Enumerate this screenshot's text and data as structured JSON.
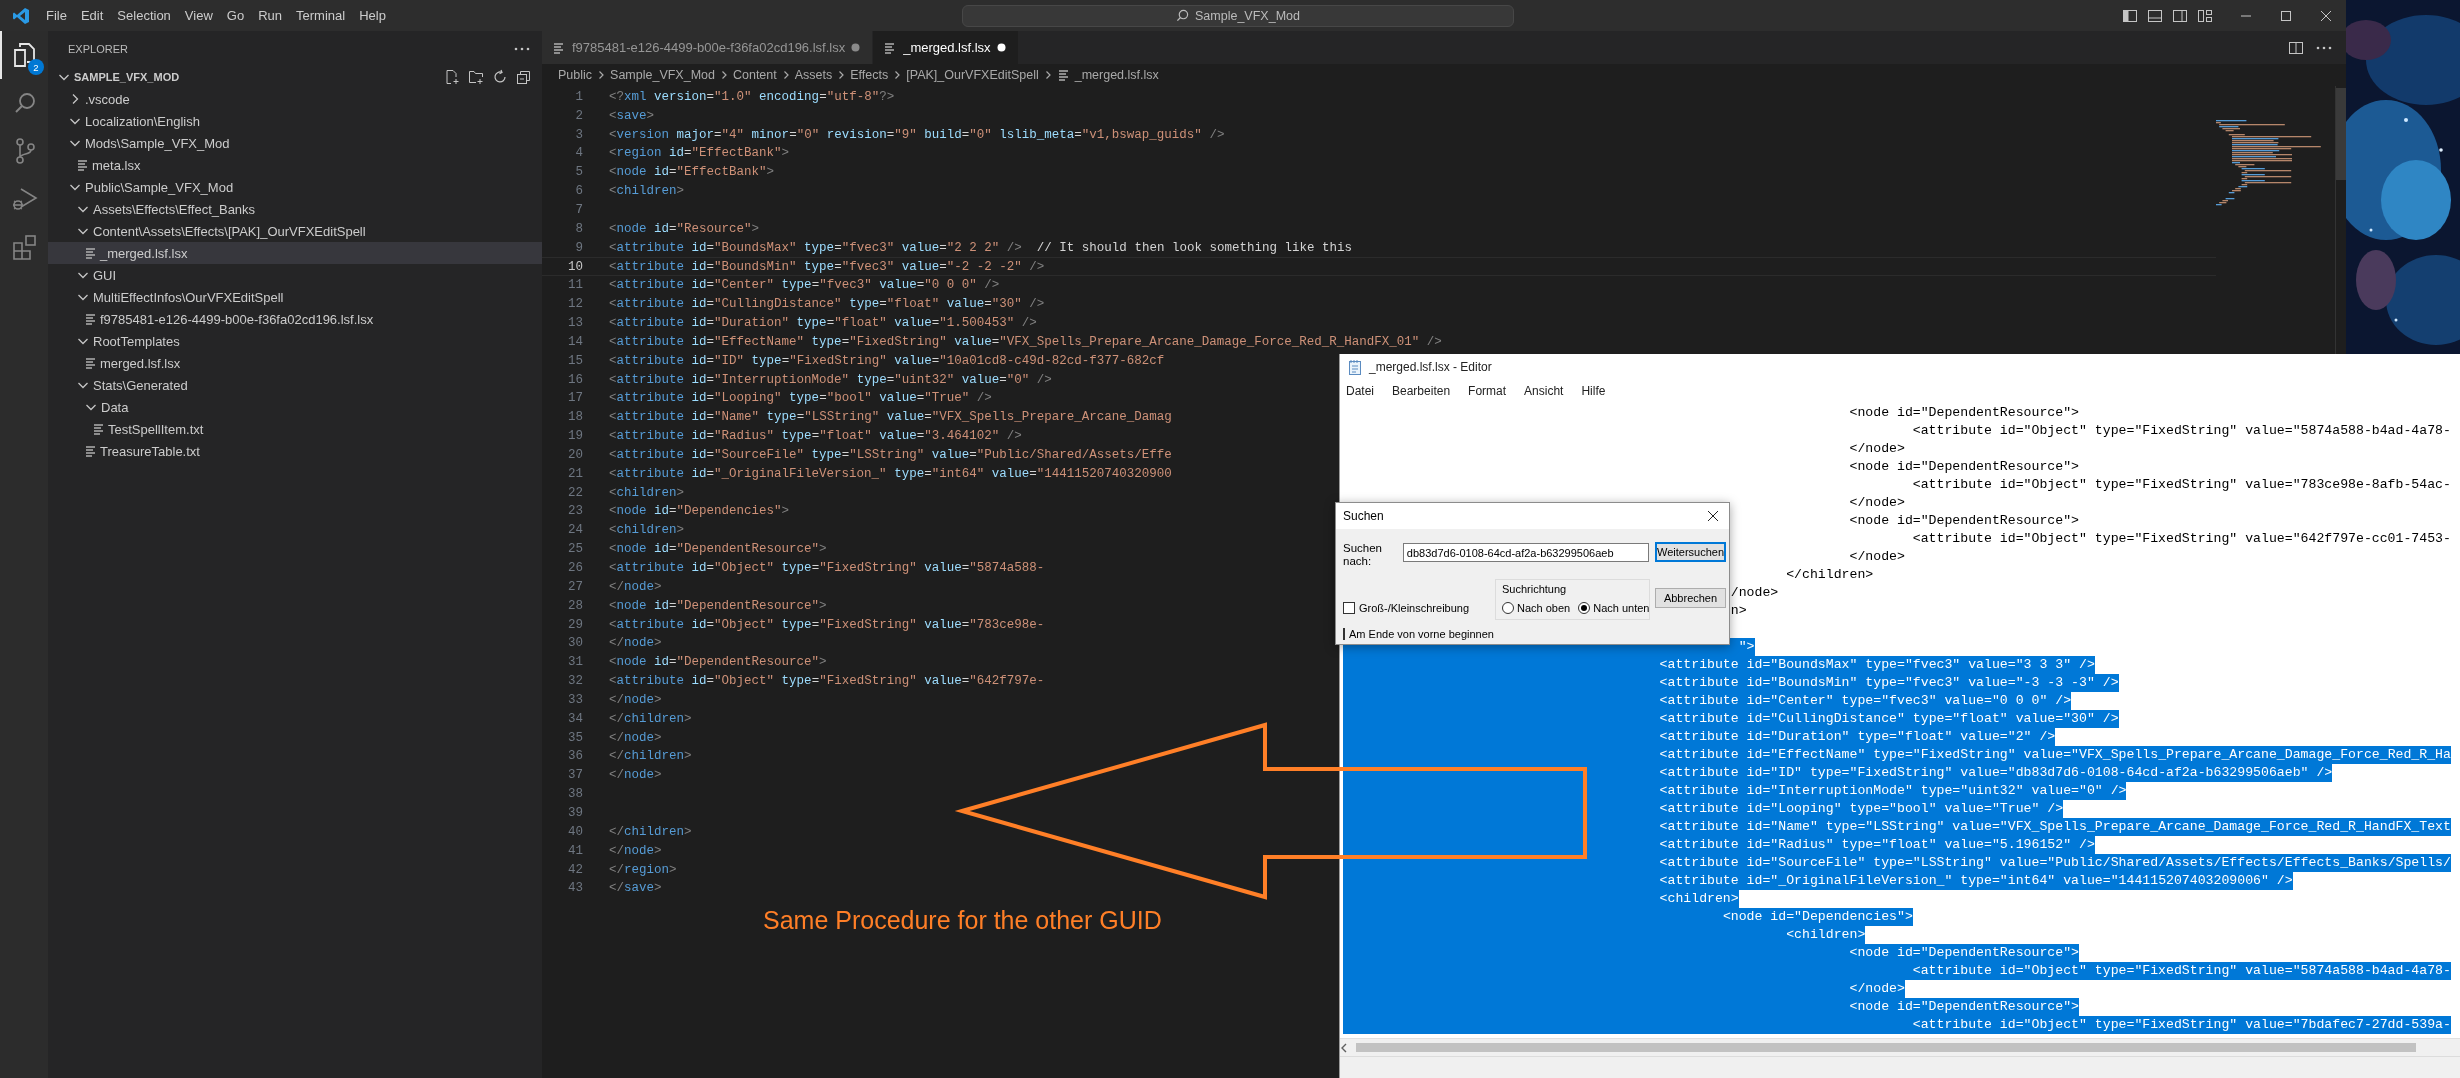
{
  "titlebar": {
    "menu": [
      "File",
      "Edit",
      "Selection",
      "View",
      "Go",
      "Run",
      "Terminal",
      "Help"
    ],
    "search": "Sample_VFX_Mod"
  },
  "activity_bar": [
    {
      "kind": "files",
      "selected": true,
      "badge": "2"
    },
    {
      "kind": "search",
      "selected": false
    },
    {
      "kind": "source_control",
      "selected": false
    },
    {
      "kind": "run",
      "selected": false
    },
    {
      "kind": "extensions",
      "selected": false
    }
  ],
  "explorer": {
    "title": "EXPLORER",
    "root": {
      "label": "SAMPLE_VFX_MOD",
      "expanded": true
    },
    "tree": [
      {
        "label": ".vscode",
        "kind": "folder",
        "expanded": false,
        "selected": false
      },
      {
        "label": "Localization\\English",
        "kind": "folder",
        "expanded": true,
        "selected": false
      },
      {
        "label": "Mods\\Sample_VFX_Mod",
        "kind": "folder",
        "expanded": true,
        "selected": false,
        "children": [
          {
            "label": "meta.lsx",
            "kind": "file",
            "selected": false
          }
        ]
      },
      {
        "label": "Public\\Sample_VFX_Mod",
        "kind": "folder",
        "expanded": true,
        "selected": false,
        "children": [
          {
            "label": "Assets\\Effects\\Effect_Banks",
            "kind": "folder",
            "expanded": true,
            "selected": false
          },
          {
            "label": "Content\\Assets\\Effects\\[PAK]_OurVFXEditSpell",
            "kind": "folder",
            "expanded": true,
            "selected": false,
            "children": [
              {
                "label": "_merged.lsf.lsx",
                "kind": "file",
                "selected": true
              }
            ]
          },
          {
            "label": "GUI",
            "kind": "folder",
            "expanded": true,
            "selected": false
          },
          {
            "label": "MultiEffectInfos\\OurVFXEditSpell",
            "kind": "folder",
            "expanded": true,
            "selected": false,
            "children": [
              {
                "label": "f9785481-e126-4499-b00e-f36fa02cd196.lsf.lsx",
                "kind": "file",
                "selected": false
              }
            ]
          },
          {
            "label": "RootTemplates",
            "kind": "folder",
            "expanded": true,
            "selected": false,
            "children": [
              {
                "label": "merged.lsf.lsx",
                "kind": "file",
                "selected": false
              }
            ]
          },
          {
            "label": "Stats\\Generated",
            "kind": "folder",
            "expanded": true,
            "selected": false,
            "children": [
              {
                "label": "Data",
                "kind": "folder",
                "expanded": true,
                "selected": false,
                "children": [
                  {
                    "label": "TestSpellItem.txt",
                    "kind": "file",
                    "selected": false
                  }
                ]
              },
              {
                "label": "TreasureTable.txt",
                "kind": "file",
                "selected": false
              }
            ]
          }
        ]
      }
    ]
  },
  "tabs": [
    {
      "label": "f9785481-e126-4499-b00e-f36fa02cd196.lsf.lsx",
      "selected": false,
      "modified": true
    },
    {
      "label": "_merged.lsf.lsx",
      "selected": true,
      "modified": true
    }
  ],
  "breadcrumb": [
    "Public",
    "Sample_VFX_Mod",
    "Content",
    "Assets",
    "Effects",
    "[PAK]_OurVFXEditSpell",
    "_merged.lsf.lsx"
  ],
  "editor": {
    "lines": [
      {
        "n": "1",
        "text": "<?xml version=\"1.0\" encoding=\"utf-8\"?>",
        "current": false
      },
      {
        "n": "2",
        "text": "<save>",
        "current": false
      },
      {
        "n": "3",
        "text": "    <version major=\"4\" minor=\"0\" revision=\"9\" build=\"0\" lslib_meta=\"v1,bswap_guids\" />",
        "current": false
      },
      {
        "n": "4",
        "text": "    <region id=\"EffectBank\">",
        "current": false
      },
      {
        "n": "5",
        "text": "        <node id=\"EffectBank\">",
        "current": false
      },
      {
        "n": "6",
        "text": "            <children>",
        "current": false
      },
      {
        "n": "7",
        "current": false
      },
      {
        "n": "8",
        "text": "                <node id=\"Resource\">",
        "current": false
      },
      {
        "n": "9",
        "text": "                    <attribute id=\"BoundsMax\" type=\"fvec3\" value=\"2 2 2\" />  // It should then look something like this",
        "current": false
      },
      {
        "n": "10",
        "text": "                    <attribute id=\"BoundsMin\" type=\"fvec3\" value=\"-2 -2 -2\" />",
        "current": true
      },
      {
        "n": "11",
        "text": "                    <attribute id=\"Center\" type=\"fvec3\" value=\"0 0 0\" />",
        "current": false
      },
      {
        "n": "12",
        "text": "                    <attribute id=\"CullingDistance\" type=\"float\" value=\"30\" />",
        "current": false
      },
      {
        "n": "13",
        "text": "                    <attribute id=\"Duration\" type=\"float\" value=\"1.500453\" />",
        "current": false
      },
      {
        "n": "14",
        "text": "                    <attribute id=\"EffectName\" type=\"FixedString\" value=\"VFX_Spells_Prepare_Arcane_Damage_Force_Red_R_HandFX_01\" />",
        "current": false
      },
      {
        "n": "15",
        "text": "                    <attribute id=\"ID\" type=\"FixedString\" value=\"10a01cd8-c49d-82cd-f377-682cf",
        "current": false
      },
      {
        "n": "16",
        "text": "                    <attribute id=\"InterruptionMode\" type=\"uint32\" value=\"0\" />",
        "current": false
      },
      {
        "n": "17",
        "text": "                    <attribute id=\"Looping\" type=\"bool\" value=\"True\" />",
        "current": false
      },
      {
        "n": "18",
        "text": "                    <attribute id=\"Name\" type=\"LSString\" value=\"VFX_Spells_Prepare_Arcane_Damag",
        "current": false
      },
      {
        "n": "19",
        "text": "                    <attribute id=\"Radius\" type=\"float\" value=\"3.464102\" />",
        "current": false
      },
      {
        "n": "20",
        "text": "                    <attribute id=\"SourceFile\" type=\"LSString\" value=\"Public/Shared/Assets/Effe",
        "current": false
      },
      {
        "n": "21",
        "text": "                    <attribute id=\"_OriginalFileVersion_\" type=\"int64\" value=\"14411520740320900",
        "current": false
      },
      {
        "n": "22",
        "text": "                    <children>",
        "current": false
      },
      {
        "n": "23",
        "text": "                        <node id=\"Dependencies\">",
        "current": false
      },
      {
        "n": "24",
        "text": "                            <children>",
        "current": false
      },
      {
        "n": "25",
        "text": "                                <node id=\"DependentResource\">",
        "current": false
      },
      {
        "n": "26",
        "text": "                                    <attribute id=\"Object\" type=\"FixedString\" value=\"5874a588-",
        "current": false
      },
      {
        "n": "27",
        "text": "                                </node>",
        "current": false
      },
      {
        "n": "28",
        "text": "                                <node id=\"DependentResource\">",
        "current": false
      },
      {
        "n": "29",
        "text": "                                    <attribute id=\"Object\" type=\"FixedString\" value=\"783ce98e-",
        "current": false
      },
      {
        "n": "30",
        "text": "                                </node>",
        "current": false
      },
      {
        "n": "31",
        "text": "                                <node id=\"DependentResource\">",
        "current": false
      },
      {
        "n": "32",
        "text": "                                    <attribute id=\"Object\" type=\"FixedString\" value=\"642f797e-",
        "current": false
      },
      {
        "n": "33",
        "text": "                                </node>",
        "current": false
      },
      {
        "n": "34",
        "text": "                            </children>",
        "current": false
      },
      {
        "n": "35",
        "text": "                        </node>",
        "current": false
      },
      {
        "n": "36",
        "text": "                    </children>",
        "current": false
      },
      {
        "n": "37",
        "text": "                </node>",
        "current": false
      },
      {
        "n": "38",
        "current": false
      },
      {
        "n": "39",
        "current": false
      },
      {
        "n": "40",
        "text": "            </children>",
        "current": false
      },
      {
        "n": "41",
        "text": "        </node>",
        "current": false
      },
      {
        "n": "42",
        "text": "    </region>",
        "current": false
      },
      {
        "n": "43",
        "text": "</save>",
        "current": false
      }
    ]
  },
  "notepad": {
    "title": "_merged.lsf.lsx - Editor",
    "menu": [
      "Datei",
      "Bearbeiten",
      "Format",
      "Ansicht",
      "Hilfe"
    ],
    "lines": [
      {
        "text": "\t\t\t\t\t\t\t\t<node id=\"DependentResource\">",
        "selected": false
      },
      {
        "text": "\t\t\t\t\t\t\t\t\t<attribute id=\"Object\" type=\"FixedString\" value=\"5874a588-b4ad-4a78-",
        "selected": false
      },
      {
        "text": "\t\t\t\t\t\t\t\t</node>",
        "selected": false
      },
      {
        "text": "\t\t\t\t\t\t\t\t<node id=\"DependentResource\">",
        "selected": false
      },
      {
        "text": "\t\t\t\t\t\t\t\t\t<attribute id=\"Object\" type=\"FixedString\" value=\"783ce98e-8afb-54ac-",
        "selected": false
      },
      {
        "text": "\t\t\t\t\t\t\t\t</node>",
        "selected": false
      },
      {
        "text": "\t\t\t\t\t\t\t\t<node id=\"DependentResource\">",
        "selected": false
      },
      {
        "text": "\t\t\t\t\t\t\t\t\t<attribute id=\"Object\" type=\"FixedString\" value=\"642f797e-cc01-7453-",
        "selected": false
      },
      {
        "text": "\t\t\t\t\t\t\t\t</node>",
        "selected": false
      },
      {
        "text": "\t\t\t\t\t\t\t</children>",
        "selected": false
      },
      {
        "text": "\t\t\t\t\t\t /node>",
        "selected": false
      },
      {
        "text": "\t\t\t\t\t         n>",
        "selected": false
      },
      {
        "selected": false
      },
      {
        "text": "\t\t\t\t                  \">",
        "selected": true
      },
      {
        "text": "\t\t\t\t\t<attribute id=\"BoundsMax\" type=\"fvec3\" value=\"3 3 3\" />",
        "selected": true
      },
      {
        "text": "\t\t\t\t\t<attribute id=\"BoundsMin\" type=\"fvec3\" value=\"-3 -3 -3\" />",
        "selected": true
      },
      {
        "text": "\t\t\t\t\t<attribute id=\"Center\" type=\"fvec3\" value=\"0 0 0\" />",
        "selected": true
      },
      {
        "text": "\t\t\t\t\t<attribute id=\"CullingDistance\" type=\"float\" value=\"30\" />",
        "selected": true
      },
      {
        "text": "\t\t\t\t\t<attribute id=\"Duration\" type=\"float\" value=\"2\" />",
        "selected": true
      },
      {
        "text": "\t\t\t\t\t<attribute id=\"EffectName\" type=\"FixedString\" value=\"VFX_Spells_Prepare_Arcane_Damage_Force_Red_R_Ha",
        "selected": true
      },
      {
        "text": "\t\t\t\t\t<attribute id=\"ID\" type=\"FixedString\" value=\"db83d7d6-0108-64cd-af2a-b63299506aeb\" />",
        "selected": true
      },
      {
        "text": "\t\t\t\t\t<attribute id=\"InterruptionMode\" type=\"uint32\" value=\"0\" />",
        "selected": true
      },
      {
        "text": "\t\t\t\t\t<attribute id=\"Looping\" type=\"bool\" value=\"True\" />",
        "selected": true
      },
      {
        "text": "\t\t\t\t\t<attribute id=\"Name\" type=\"LSString\" value=\"VFX_Spells_Prepare_Arcane_Damage_Force_Red_R_HandFX_Text",
        "selected": true
      },
      {
        "text": "\t\t\t\t\t<attribute id=\"Radius\" type=\"float\" value=\"5.196152\" />",
        "selected": true
      },
      {
        "text": "\t\t\t\t\t<attribute id=\"SourceFile\" type=\"LSString\" value=\"Public/Shared/Assets/Effects/Effects_Banks/Spells/",
        "selected": true
      },
      {
        "text": "\t\t\t\t\t<attribute id=\"_OriginalFileVersion_\" type=\"int64\" value=\"144115207403209006\" />",
        "selected": true
      },
      {
        "text": "\t\t\t\t\t<children>",
        "selected": true
      },
      {
        "text": "\t\t\t\t\t\t<node id=\"Dependencies\">",
        "selected": true
      },
      {
        "text": "\t\t\t\t\t\t\t<children>",
        "selected": true
      },
      {
        "text": "\t\t\t\t\t\t\t\t<node id=\"DependentResource\">",
        "selected": true
      },
      {
        "text": "\t\t\t\t\t\t\t\t\t<attribute id=\"Object\" type=\"FixedString\" value=\"5874a588-b4ad-4a78-",
        "selected": true
      },
      {
        "text": "\t\t\t\t\t\t\t\t</node>",
        "selected": true
      },
      {
        "text": "\t\t\t\t\t\t\t\t<node id=\"DependentResource\">",
        "selected": true
      },
      {
        "text": "\t\t\t\t\t\t\t\t\t<attribute id=\"Object\" type=\"FixedString\" value=\"7bdafec7-27dd-539a-",
        "selected": true
      }
    ]
  },
  "find_dialog": {
    "title": "Suchen",
    "label": "Suchen nach:",
    "value": "db83d7d6-0108-64cd-af2a-b63299506aeb",
    "buttons": [
      {
        "label": "Weitersuchen",
        "default": true
      },
      {
        "label": "Abbrechen",
        "default": false
      }
    ],
    "direction": {
      "label": "Suchrichtung",
      "options": [
        {
          "label": "Nach oben",
          "selected": false
        },
        {
          "label": "Nach unten",
          "selected": true
        }
      ]
    },
    "checkboxes": [
      {
        "label": "Groß-/Kleinschreibung",
        "checked": false
      },
      {
        "label": "Am Ende von vorne beginnen",
        "checked": false
      }
    ]
  },
  "annotation": {
    "text": "Same Procedure for the other GUID"
  }
}
